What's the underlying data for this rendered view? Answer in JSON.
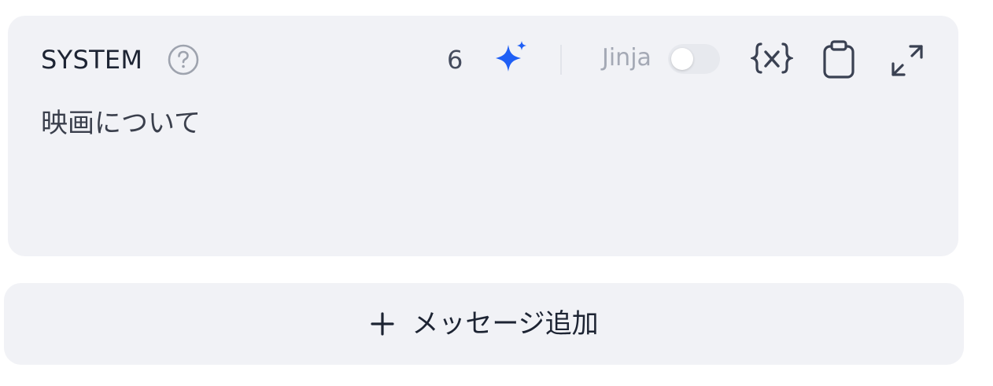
{
  "system_card": {
    "role_label": "SYSTEM",
    "token_count": "6",
    "jinja_label": "Jinja",
    "jinja_enabled": false,
    "prompt_text": "映画について",
    "icons": {
      "help": "help-circle-icon",
      "sparkle": "ai-sparkle-icon",
      "variable": "variable-braces-icon",
      "clipboard": "clipboard-icon",
      "expand": "expand-icon"
    }
  },
  "add_message": {
    "label": "メッセージ追加",
    "icon": "plus-icon"
  },
  "colors": {
    "card_background": "#f1f2f6",
    "accent": "#1f5ff5",
    "text_primary": "#1d2433",
    "icon": "#3a4152"
  }
}
